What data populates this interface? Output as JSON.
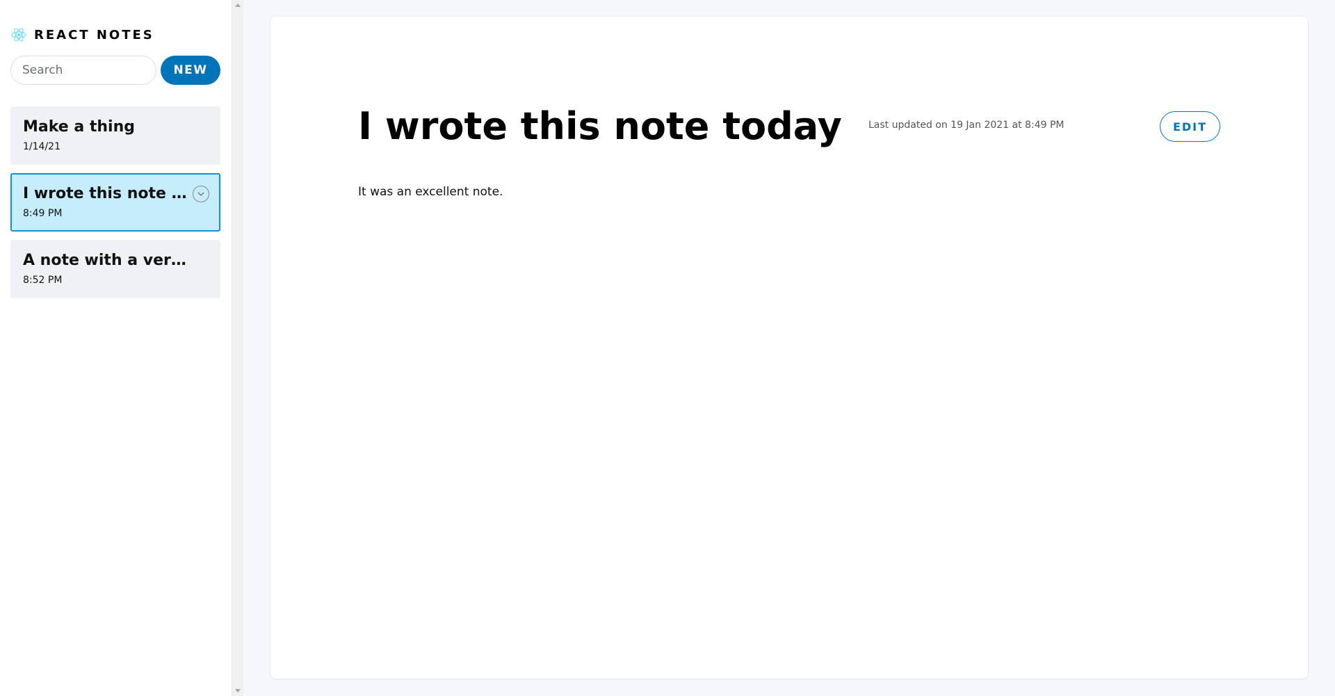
{
  "sidebar": {
    "brand": {
      "title": "REACT NOTES",
      "icon": "react-atom-icon",
      "accent": "#61dafb"
    },
    "search": {
      "placeholder": "Search",
      "value": ""
    },
    "new_label": "NEW",
    "notes": [
      {
        "title": "Make a thing",
        "date": "1/14/21",
        "active": false
      },
      {
        "title": "I wrote this note tod...",
        "date": "8:49 PM",
        "active": true,
        "expand_icon": "chevron-down-icon"
      },
      {
        "title": "A note with a very lo...",
        "date": "8:52 PM",
        "active": false
      }
    ]
  },
  "note": {
    "title": "I wrote this note today",
    "last_updated": "Last updated on 19 Jan 2021 at 8:49 PM",
    "edit_label": "EDIT",
    "body": "It was an excellent note."
  },
  "colors": {
    "primary": "#0074b8",
    "active_bg": "#c5edfc",
    "active_border": "#0e92d6",
    "item_bg": "#eff1f4",
    "page_bg": "#f5f7fa"
  }
}
